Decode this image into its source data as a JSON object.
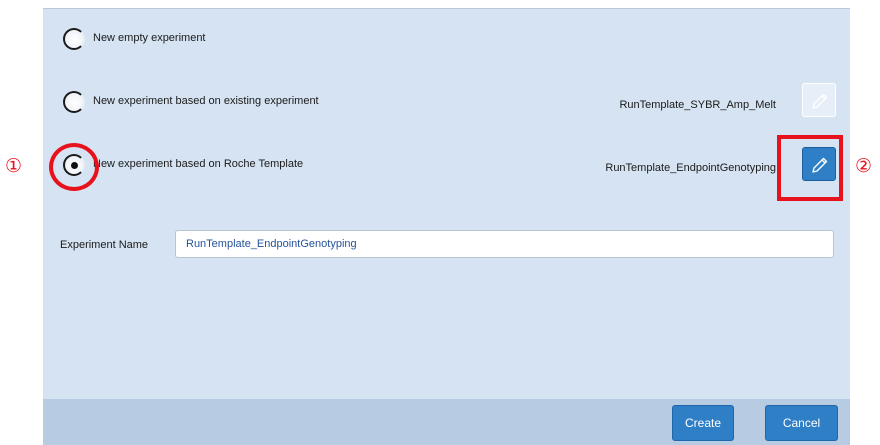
{
  "options": [
    {
      "label": "New empty experiment",
      "checked": false
    },
    {
      "label": "New experiment based on existing experiment",
      "checked": false,
      "template": "RunTemplate_SYBR_Amp_Melt",
      "edit_enabled": false
    },
    {
      "label": "New experiment based on Roche Template",
      "checked": true,
      "template": "RunTemplate_EndpointGenotyping",
      "edit_enabled": true
    }
  ],
  "experiment_name": {
    "label": "Experiment Name",
    "value": "RunTemplate_EndpointGenotyping"
  },
  "buttons": {
    "create": "Create",
    "cancel": "Cancel"
  },
  "annotations": {
    "marker_1": "①",
    "marker_2": "②",
    "color": "#e8121d"
  },
  "icons": {
    "edit": "pencil-icon"
  },
  "colors": {
    "panel_bg": "#d6e3f2",
    "footer_bg": "#b7cbe3",
    "accent_button": "#2f7fc7"
  }
}
